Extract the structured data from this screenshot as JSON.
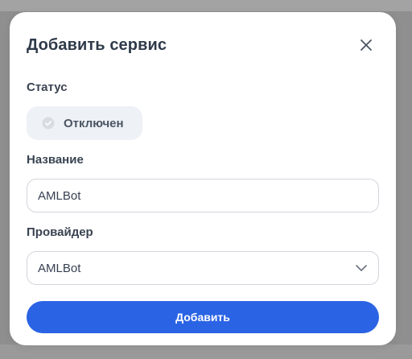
{
  "modal": {
    "title": "Добавить сервис",
    "close_icon": "close-icon"
  },
  "status": {
    "label": "Статус",
    "value": "Отключен",
    "enabled": false,
    "icon": "check-circle-icon"
  },
  "name_field": {
    "label": "Название",
    "value": "AMLBot"
  },
  "provider_field": {
    "label": "Провайдер",
    "selected": "AMLBot",
    "icon": "chevron-down-icon"
  },
  "submit": {
    "label": "Добавить",
    "color": "#2a63e4"
  }
}
